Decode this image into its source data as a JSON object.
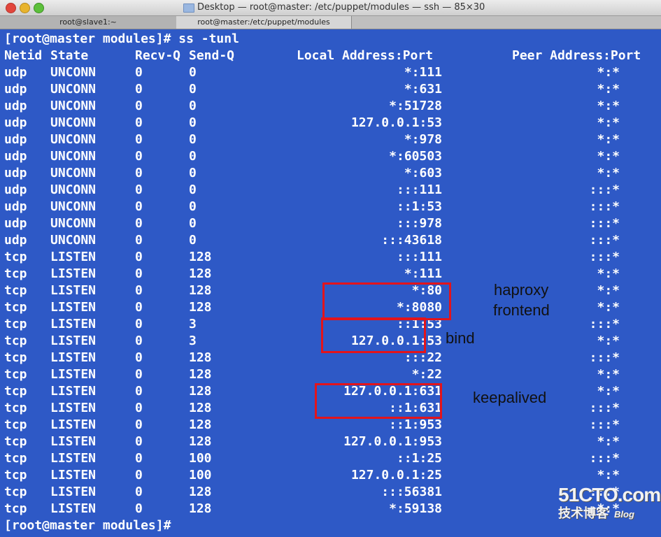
{
  "window": {
    "title": "Desktop — root@master: /etc/puppet/modules — ssh — 85×30",
    "tabs": [
      "root@slave1:~",
      "root@master:/etc/puppet/modules"
    ]
  },
  "terminal": {
    "prompt_command": "[root@master modules]# ss -tunl",
    "headers": {
      "netid": "Netid",
      "state": "State",
      "recvq": "Recv-Q",
      "sendq": "Send-Q",
      "local": "Local Address:Port",
      "peer": "Peer Address:Port"
    },
    "rows": [
      {
        "netid": "udp",
        "state": "UNCONN",
        "recvq": "0",
        "sendq": "0",
        "local": "*:111",
        "peer": "*:*"
      },
      {
        "netid": "udp",
        "state": "UNCONN",
        "recvq": "0",
        "sendq": "0",
        "local": "*:631",
        "peer": "*:*"
      },
      {
        "netid": "udp",
        "state": "UNCONN",
        "recvq": "0",
        "sendq": "0",
        "local": "*:51728",
        "peer": "*:*"
      },
      {
        "netid": "udp",
        "state": "UNCONN",
        "recvq": "0",
        "sendq": "0",
        "local": "127.0.0.1:53",
        "peer": "*:*"
      },
      {
        "netid": "udp",
        "state": "UNCONN",
        "recvq": "0",
        "sendq": "0",
        "local": "*:978",
        "peer": "*:*"
      },
      {
        "netid": "udp",
        "state": "UNCONN",
        "recvq": "0",
        "sendq": "0",
        "local": "*:60503",
        "peer": "*:*"
      },
      {
        "netid": "udp",
        "state": "UNCONN",
        "recvq": "0",
        "sendq": "0",
        "local": "*:603",
        "peer": "*:*"
      },
      {
        "netid": "udp",
        "state": "UNCONN",
        "recvq": "0",
        "sendq": "0",
        "local": ":::111",
        "peer": ":::*"
      },
      {
        "netid": "udp",
        "state": "UNCONN",
        "recvq": "0",
        "sendq": "0",
        "local": "::1:53",
        "peer": ":::*"
      },
      {
        "netid": "udp",
        "state": "UNCONN",
        "recvq": "0",
        "sendq": "0",
        "local": ":::978",
        "peer": ":::*"
      },
      {
        "netid": "udp",
        "state": "UNCONN",
        "recvq": "0",
        "sendq": "0",
        "local": ":::43618",
        "peer": ":::*"
      },
      {
        "netid": "tcp",
        "state": "LISTEN",
        "recvq": "0",
        "sendq": "128",
        "local": ":::111",
        "peer": ":::*"
      },
      {
        "netid": "tcp",
        "state": "LISTEN",
        "recvq": "0",
        "sendq": "128",
        "local": "*:111",
        "peer": "*:*"
      },
      {
        "netid": "tcp",
        "state": "LISTEN",
        "recvq": "0",
        "sendq": "128",
        "local": "*:80",
        "peer": "*:*"
      },
      {
        "netid": "tcp",
        "state": "LISTEN",
        "recvq": "0",
        "sendq": "128",
        "local": "*:8080",
        "peer": "*:*"
      },
      {
        "netid": "tcp",
        "state": "LISTEN",
        "recvq": "0",
        "sendq": "3",
        "local": "::1:53",
        "peer": ":::*"
      },
      {
        "netid": "tcp",
        "state": "LISTEN",
        "recvq": "0",
        "sendq": "3",
        "local": "127.0.0.1:53",
        "peer": "*:*"
      },
      {
        "netid": "tcp",
        "state": "LISTEN",
        "recvq": "0",
        "sendq": "128",
        "local": ":::22",
        "peer": ":::*"
      },
      {
        "netid": "tcp",
        "state": "LISTEN",
        "recvq": "0",
        "sendq": "128",
        "local": "*:22",
        "peer": "*:*"
      },
      {
        "netid": "tcp",
        "state": "LISTEN",
        "recvq": "0",
        "sendq": "128",
        "local": "127.0.0.1:631",
        "peer": "*:*"
      },
      {
        "netid": "tcp",
        "state": "LISTEN",
        "recvq": "0",
        "sendq": "128",
        "local": "::1:631",
        "peer": ":::*"
      },
      {
        "netid": "tcp",
        "state": "LISTEN",
        "recvq": "0",
        "sendq": "128",
        "local": "::1:953",
        "peer": ":::*"
      },
      {
        "netid": "tcp",
        "state": "LISTEN",
        "recvq": "0",
        "sendq": "128",
        "local": "127.0.0.1:953",
        "peer": "*:*"
      },
      {
        "netid": "tcp",
        "state": "LISTEN",
        "recvq": "0",
        "sendq": "100",
        "local": "::1:25",
        "peer": ":::*"
      },
      {
        "netid": "tcp",
        "state": "LISTEN",
        "recvq": "0",
        "sendq": "100",
        "local": "127.0.0.1:25",
        "peer": "*:*"
      },
      {
        "netid": "tcp",
        "state": "LISTEN",
        "recvq": "0",
        "sendq": "128",
        "local": ":::56381",
        "peer": ":::*"
      },
      {
        "netid": "tcp",
        "state": "LISTEN",
        "recvq": "0",
        "sendq": "128",
        "local": "*:59138",
        "peer": "*:*"
      }
    ],
    "final_prompt": "[root@master modules]# "
  },
  "annotations": {
    "haproxy_line1": "haproxy",
    "haproxy_line2": "frontend",
    "bind": "bind",
    "keepalived": "keepalived",
    "highlight_color": "#e3141b"
  },
  "watermark": {
    "brand": "51CTO.com",
    "sub": "技术博客",
    "blog": "Blog"
  },
  "colors": {
    "background": "#2e59c6",
    "text": "#ffffff"
  }
}
